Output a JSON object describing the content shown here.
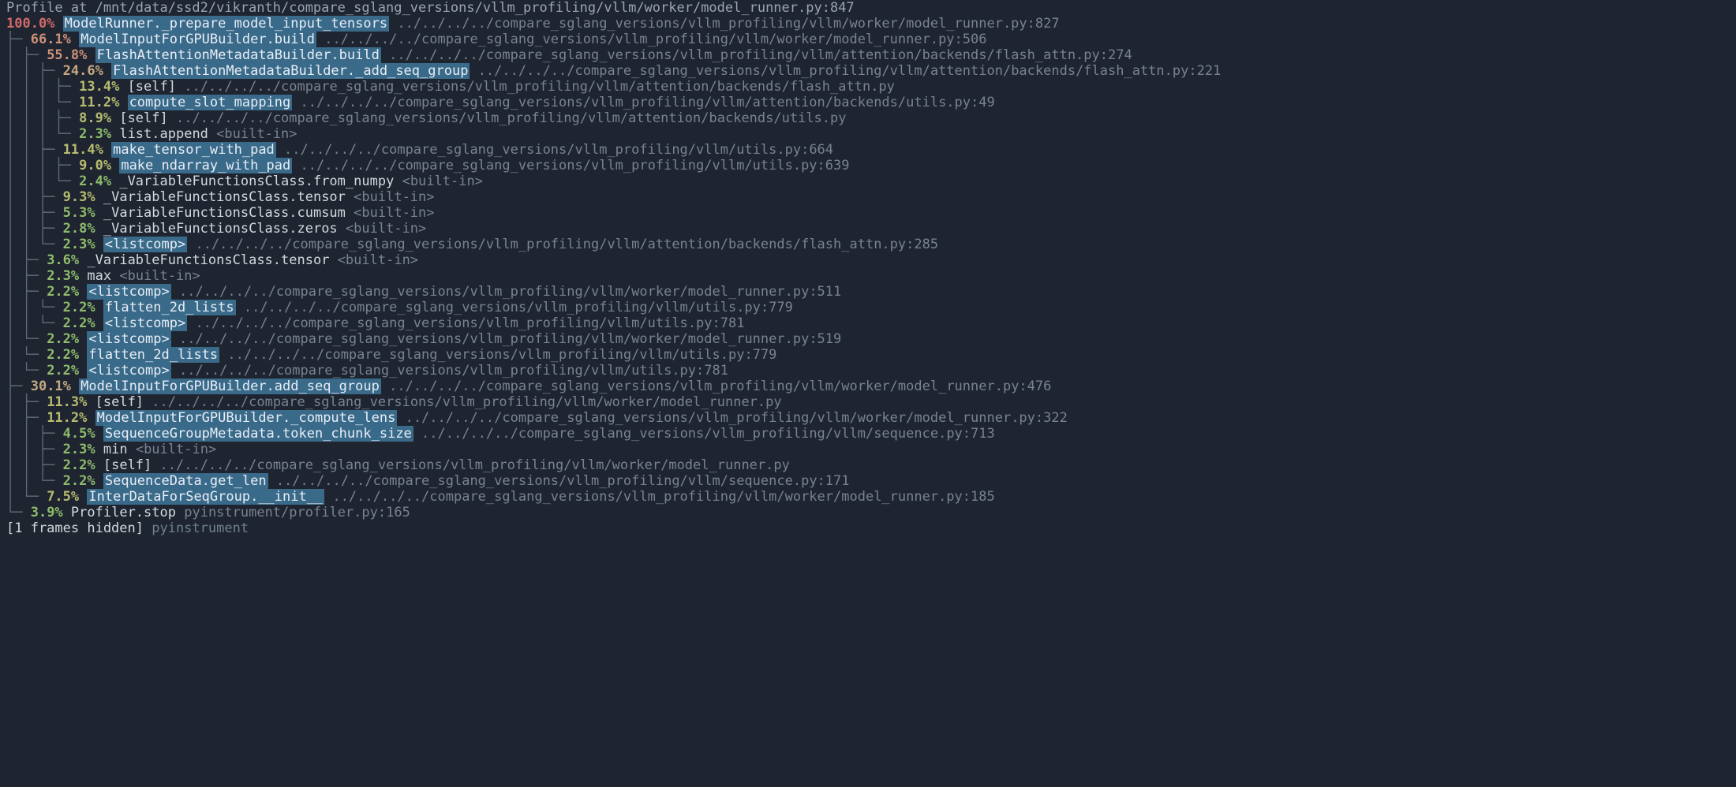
{
  "header": "Profile at /mnt/data/ssd2/vikranth/compare_sglang_versions/vllm_profiling/vllm/worker/model_runner.py:847",
  "lines": [
    {
      "tree": "",
      "pct": "100.0%",
      "color": "c-red",
      "fn": "ModelRunner._prepare_model_input_tensors",
      "hl": true,
      "sep": "  ",
      "path": "../../../../compare_sglang_versions/vllm_profiling/vllm/worker/model_runner.py:827"
    },
    {
      "tree": "├─ ",
      "pct": "66.1%",
      "color": "c-orange",
      "fn": "ModelInputForGPUBuilder.build",
      "hl": true,
      "sep": "  ",
      "path": "../../../../compare_sglang_versions/vllm_profiling/vllm/worker/model_runner.py:506"
    },
    {
      "tree": "│  ├─ ",
      "pct": "55.8%",
      "color": "c-orange",
      "fn": "FlashAttentionMetadataBuilder.build",
      "hl": true,
      "sep": "  ",
      "path": "../../../../compare_sglang_versions/vllm_profiling/vllm/attention/backends/flash_attn.py:274"
    },
    {
      "tree": "│  │  ├─ ",
      "pct": "24.6%",
      "color": "c-tan",
      "fn": "FlashAttentionMetadataBuilder._add_seq_group",
      "hl": true,
      "sep": "  ",
      "path": "../../../../compare_sglang_versions/vllm_profiling/vllm/attention/backends/flash_attn.py:221"
    },
    {
      "tree": "│  │  │  ├─ ",
      "pct": "13.4%",
      "color": "c-olive",
      "fn": "[self]",
      "hl": false,
      "sep": "  ",
      "path": "../../../../compare_sglang_versions/vllm_profiling/vllm/attention/backends/flash_attn.py"
    },
    {
      "tree": "│  │  │  └─ ",
      "pct": "11.2%",
      "color": "c-olive",
      "fn": "compute_slot_mapping",
      "hl": true,
      "sep": "  ",
      "path": "../../../../compare_sglang_versions/vllm_profiling/vllm/attention/backends/utils.py:49"
    },
    {
      "tree": "│  │  │     ├─ ",
      "pct": "8.9%",
      "color": "c-olive",
      "fn": "[self]",
      "hl": false,
      "sep": "  ",
      "path": "../../../../compare_sglang_versions/vllm_profiling/vllm/attention/backends/utils.py"
    },
    {
      "tree": "│  │  │     └─ ",
      "pct": "2.3%",
      "color": "c-green",
      "fn": "list.append",
      "hl": false,
      "sep": "  ",
      "path": "<built-in>"
    },
    {
      "tree": "│  │  ├─ ",
      "pct": "11.4%",
      "color": "c-olive",
      "fn": "make_tensor_with_pad",
      "hl": true,
      "sep": "  ",
      "path": "../../../../compare_sglang_versions/vllm_profiling/vllm/utils.py:664"
    },
    {
      "tree": "│  │  │  ├─ ",
      "pct": "9.0%",
      "color": "c-olive",
      "fn": "make_ndarray_with_pad",
      "hl": true,
      "sep": "  ",
      "path": "../../../../compare_sglang_versions/vllm_profiling/vllm/utils.py:639"
    },
    {
      "tree": "│  │  │  └─ ",
      "pct": "2.4%",
      "color": "c-green",
      "fn": "_VariableFunctionsClass.from_numpy",
      "hl": false,
      "sep": "  ",
      "path": "<built-in>"
    },
    {
      "tree": "│  │  ├─ ",
      "pct": "9.3%",
      "color": "c-olive",
      "fn": "_VariableFunctionsClass.tensor",
      "hl": false,
      "sep": "  ",
      "path": "<built-in>"
    },
    {
      "tree": "│  │  ├─ ",
      "pct": "5.3%",
      "color": "c-green",
      "fn": "_VariableFunctionsClass.cumsum",
      "hl": false,
      "sep": "  ",
      "path": "<built-in>"
    },
    {
      "tree": "│  │  ├─ ",
      "pct": "2.8%",
      "color": "c-green",
      "fn": "_VariableFunctionsClass.zeros",
      "hl": false,
      "sep": "  ",
      "path": "<built-in>"
    },
    {
      "tree": "│  │  └─ ",
      "pct": "2.3%",
      "color": "c-green",
      "fn": "<listcomp>",
      "hl": true,
      "sep": "  ",
      "path": "../../../../compare_sglang_versions/vllm_profiling/vllm/attention/backends/flash_attn.py:285"
    },
    {
      "tree": "│  ├─ ",
      "pct": "3.6%",
      "color": "c-green",
      "fn": "_VariableFunctionsClass.tensor",
      "hl": false,
      "sep": "  ",
      "path": "<built-in>"
    },
    {
      "tree": "│  ├─ ",
      "pct": "2.3%",
      "color": "c-green",
      "fn": "max",
      "hl": false,
      "sep": "  ",
      "path": "<built-in>"
    },
    {
      "tree": "│  ├─ ",
      "pct": "2.2%",
      "color": "c-green",
      "fn": "<listcomp>",
      "hl": true,
      "sep": "  ",
      "path": "../../../../compare_sglang_versions/vllm_profiling/vllm/worker/model_runner.py:511"
    },
    {
      "tree": "│  │  └─ ",
      "pct": "2.2%",
      "color": "c-green",
      "fn": "flatten_2d_lists",
      "hl": true,
      "sep": "  ",
      "path": "../../../../compare_sglang_versions/vllm_profiling/vllm/utils.py:779"
    },
    {
      "tree": "│  │     └─ ",
      "pct": "2.2%",
      "color": "c-green",
      "fn": "<listcomp>",
      "hl": true,
      "sep": "  ",
      "path": "../../../../compare_sglang_versions/vllm_profiling/vllm/utils.py:781"
    },
    {
      "tree": "│  └─ ",
      "pct": "2.2%",
      "color": "c-green",
      "fn": "<listcomp>",
      "hl": true,
      "sep": "  ",
      "path": "../../../../compare_sglang_versions/vllm_profiling/vllm/worker/model_runner.py:519"
    },
    {
      "tree": "│     └─ ",
      "pct": "2.2%",
      "color": "c-green",
      "fn": "flatten_2d_lists",
      "hl": true,
      "sep": "  ",
      "path": "../../../../compare_sglang_versions/vllm_profiling/vllm/utils.py:779"
    },
    {
      "tree": "│        └─ ",
      "pct": "2.2%",
      "color": "c-green",
      "fn": "<listcomp>",
      "hl": true,
      "sep": "  ",
      "path": "../../../../compare_sglang_versions/vllm_profiling/vllm/utils.py:781"
    },
    {
      "tree": "├─ ",
      "pct": "30.1%",
      "color": "c-tan",
      "fn": "ModelInputForGPUBuilder.add_seq_group",
      "hl": true,
      "sep": "  ",
      "path": "../../../../compare_sglang_versions/vllm_profiling/vllm/worker/model_runner.py:476"
    },
    {
      "tree": "│  ├─ ",
      "pct": "11.3%",
      "color": "c-olive",
      "fn": "[self]",
      "hl": false,
      "sep": "  ",
      "path": "../../../../compare_sglang_versions/vllm_profiling/vllm/worker/model_runner.py"
    },
    {
      "tree": "│  ├─ ",
      "pct": "11.2%",
      "color": "c-olive",
      "fn": "ModelInputForGPUBuilder._compute_lens",
      "hl": true,
      "sep": "  ",
      "path": "../../../../compare_sglang_versions/vllm_profiling/vllm/worker/model_runner.py:322"
    },
    {
      "tree": "│  │  ├─ ",
      "pct": "4.5%",
      "color": "c-green",
      "fn": "SequenceGroupMetadata.token_chunk_size",
      "hl": true,
      "sep": "  ",
      "path": "../../../../compare_sglang_versions/vllm_profiling/vllm/sequence.py:713"
    },
    {
      "tree": "│  │  ├─ ",
      "pct": "2.3%",
      "color": "c-green",
      "fn": "min",
      "hl": false,
      "sep": "  ",
      "path": "<built-in>"
    },
    {
      "tree": "│  │  ├─ ",
      "pct": "2.2%",
      "color": "c-green",
      "fn": "[self]",
      "hl": false,
      "sep": "  ",
      "path": "../../../../compare_sglang_versions/vllm_profiling/vllm/worker/model_runner.py"
    },
    {
      "tree": "│  │  └─ ",
      "pct": "2.2%",
      "color": "c-green",
      "fn": "SequenceData.get_len",
      "hl": true,
      "sep": "  ",
      "path": "../../../../compare_sglang_versions/vllm_profiling/vllm/sequence.py:171"
    },
    {
      "tree": "│  └─ ",
      "pct": "7.5%",
      "color": "c-olive",
      "fn": "InterDataForSeqGroup.__init__",
      "hl": true,
      "sep": "  ",
      "path": "../../../../compare_sglang_versions/vllm_profiling/vllm/worker/model_runner.py:185"
    },
    {
      "tree": "└─ ",
      "pct": "3.9%",
      "color": "c-green",
      "fn": "Profiler.stop",
      "hl": false,
      "sep": "  ",
      "path": "pyinstrument/profiler.py:165"
    }
  ],
  "footer": {
    "tree": "      ",
    "text": "[1 frames hidden]",
    "mod": "  pyinstrument"
  }
}
